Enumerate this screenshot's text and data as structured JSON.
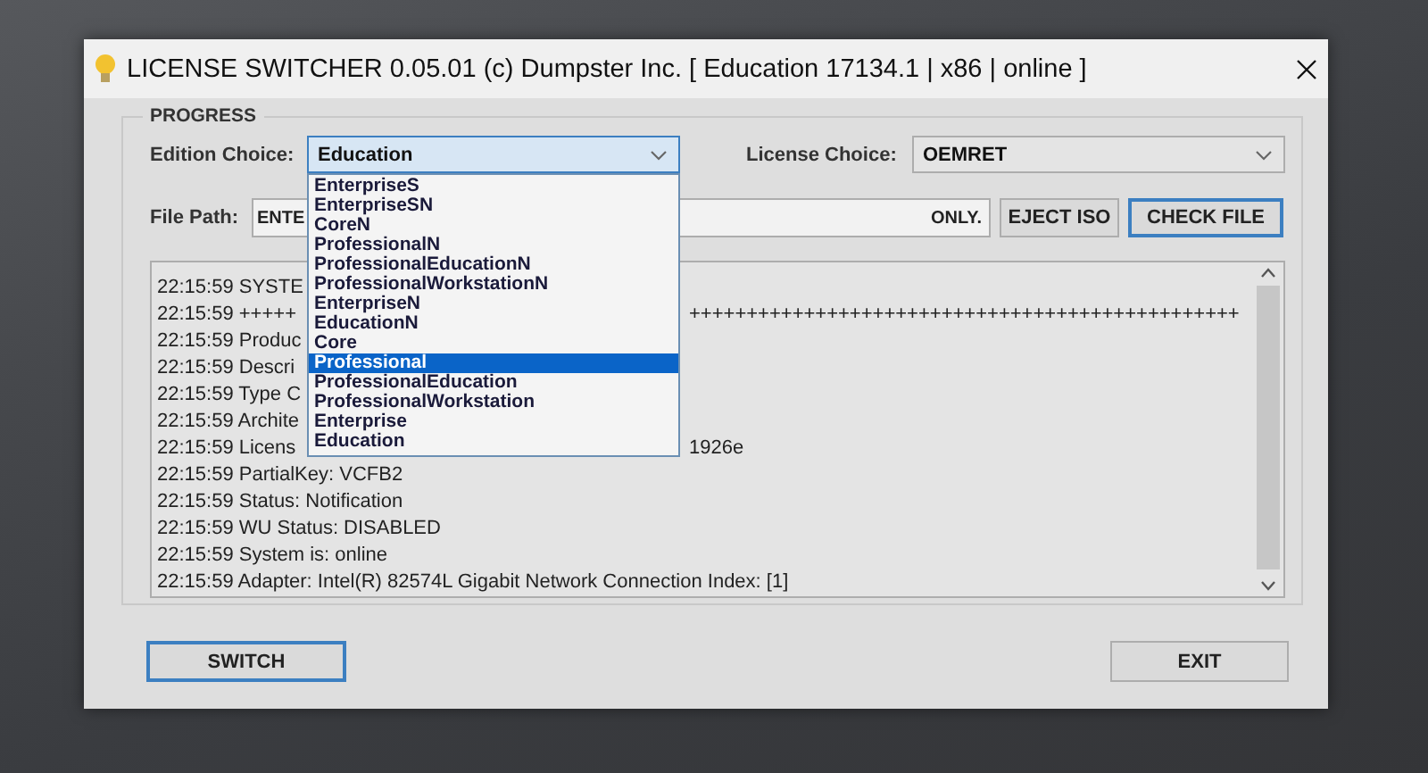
{
  "window": {
    "title": "LICENSE SWITCHER 0.05.01 (c) Dumpster Inc. [ Education 17134.1 | x86 | online ]"
  },
  "group": {
    "title": "PROGRESS"
  },
  "edition": {
    "label": "Edition Choice:",
    "value": "Education",
    "expanded": true,
    "options": [
      {
        "label": "EnterpriseS",
        "highlighted": false
      },
      {
        "label": "EnterpriseSN",
        "highlighted": false
      },
      {
        "label": "CoreN",
        "highlighted": false
      },
      {
        "label": "ProfessionalN",
        "highlighted": false
      },
      {
        "label": "ProfessionalEducationN",
        "highlighted": false
      },
      {
        "label": "ProfessionalWorkstationN",
        "highlighted": false
      },
      {
        "label": "EnterpriseN",
        "highlighted": false
      },
      {
        "label": "EducationN",
        "highlighted": false
      },
      {
        "label": "Core",
        "highlighted": false
      },
      {
        "label": "Professional",
        "highlighted": true
      },
      {
        "label": "ProfessionalEducation",
        "highlighted": false
      },
      {
        "label": "ProfessionalWorkstation",
        "highlighted": false
      },
      {
        "label": "Enterprise",
        "highlighted": false
      },
      {
        "label": "Education",
        "highlighted": false
      }
    ]
  },
  "license": {
    "label": "License Choice:",
    "value": "OEMRET"
  },
  "file_path": {
    "label": "File Path:",
    "value_left": "ENTE",
    "value_right": "ONLY."
  },
  "buttons_top": [
    {
      "label": "EJECT ISO",
      "focused": false
    },
    {
      "label": "CHECK FILE",
      "focused": true
    }
  ],
  "log": [
    {
      "kind": "covered",
      "text": "22:15:59 SYSTE"
    },
    {
      "kind": "covered",
      "text": "22:15:59 +++++",
      "tail": "++++++++++++++++++++++++++++++++++++++++++++++++"
    },
    {
      "kind": "covered",
      "text": "22:15:59 Produc"
    },
    {
      "kind": "covered",
      "text": "22:15:59 Descri"
    },
    {
      "kind": "covered",
      "text": "22:15:59 Type C"
    },
    {
      "kind": "covered",
      "text": "22:15:59 Archite"
    },
    {
      "kind": "covered",
      "text": "22:15:59 Licens",
      "tail": "1926e"
    },
    {
      "kind": "full",
      "text": "22:15:59 PartialKey: VCFB2"
    },
    {
      "kind": "full",
      "text": "22:15:59 Status: Notification"
    },
    {
      "kind": "full",
      "text": "22:15:59 WU Status: DISABLED"
    },
    {
      "kind": "full",
      "text": "22:15:59 System is: online"
    },
    {
      "kind": "full",
      "text": "22:15:59 Adapter: Intel(R) 82574L Gigabit Network Connection Index: [1]"
    }
  ],
  "buttons_bottom": [
    {
      "label": "SWITCH",
      "focused": true
    },
    {
      "label": "EXIT",
      "focused": false
    }
  ]
}
